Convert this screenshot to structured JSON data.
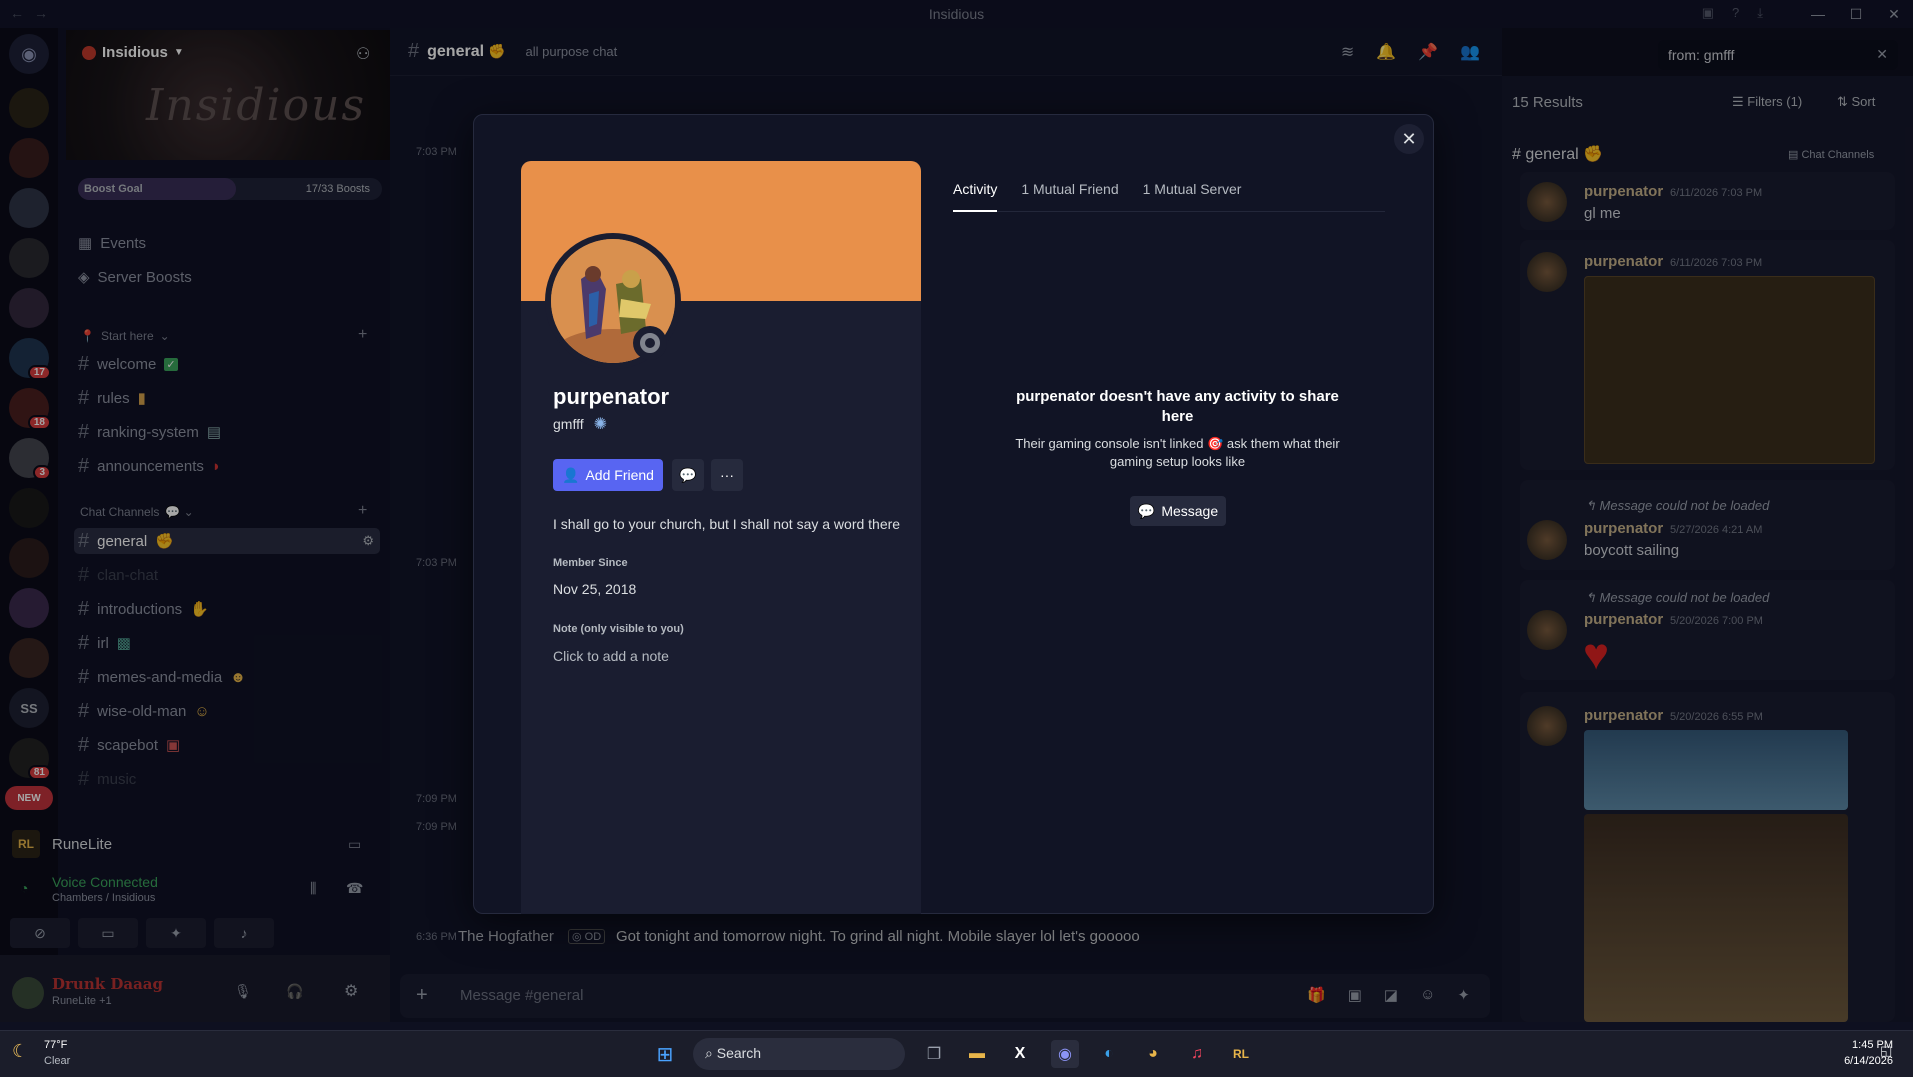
{
  "window": {
    "title": "Insidious"
  },
  "server": {
    "name": "Insidious",
    "banner_text": "Insidious",
    "boost_label": "Boost Goal",
    "boost_count": "17/33 Boosts",
    "boost_progress": 0.52,
    "menu": [
      "Events",
      "Server Boosts"
    ],
    "categories": [
      {
        "label": "Start here",
        "channels": [
          "welcome",
          "rules",
          "ranking-system",
          "announcements"
        ]
      },
      {
        "label": "Chat Channels",
        "channels": [
          "general",
          "clan-chat",
          "introductions",
          "irl",
          "memes-and-media",
          "wise-old-man",
          "scapebot",
          "music"
        ]
      }
    ],
    "server_badges": [
      "17",
      "18",
      "3",
      "81"
    ],
    "new_label": "NEW",
    "ss_label": "SS"
  },
  "sidebar_bottom": {
    "app_name": "RuneLite",
    "voice_status": "Voice Connected",
    "voice_channel": "Chambers / Insidious",
    "user_name": "Drunk Daaag",
    "user_activity": "RuneLite +1"
  },
  "chat": {
    "channel": "general",
    "topic": "all purpose chat",
    "input_placeholder": "Message #general",
    "bottom_msg_time": "6:36 PM",
    "bottom_msg_author": "The Hogfather",
    "bottom_msg_text": "Got tonight and tomorrow night. To grind all night. Mobile slayer lol let's gooooo",
    "bg_times": [
      "7:03 PM",
      "7:03 PM",
      "7:09 PM",
      "7:09 PM"
    ]
  },
  "search": {
    "query": "from: gmfff",
    "results_count": "15 Results",
    "filters_label": "Filters (1)",
    "sort_label": "Sort",
    "channel": "general",
    "channel_category": "Chat Channels",
    "results": [
      {
        "author": "purpenator",
        "time": "6/11/2026 7:03 PM",
        "text": "gl me"
      },
      {
        "author": "purpenator",
        "time": "6/11/2026 7:03 PM",
        "text": ""
      },
      {
        "author": "purpenator",
        "time": "5/27/2026 4:21 AM",
        "text": "boycott sailing",
        "reply": "Message could not be loaded"
      },
      {
        "author": "purpenator",
        "time": "5/20/2026 7:00 PM",
        "text": "",
        "reply": "Message could not be loaded"
      },
      {
        "author": "purpenator",
        "time": "5/20/2026 6:55 PM",
        "text": ""
      }
    ]
  },
  "profile": {
    "display_name": "purpenator",
    "username": "gmfff",
    "banner_color": "#e8904a",
    "add_friend_label": "Add Friend",
    "bio": "I shall go to your church, but I shall not say a word there",
    "member_since_label": "Member Since",
    "member_since": "Nov 25, 2018",
    "note_label": "Note (only visible to you)",
    "note_placeholder": "Click to add a note",
    "tabs": [
      "Activity",
      "1 Mutual Friend",
      "1 Mutual Server"
    ],
    "empty_title": "purpenator doesn't have any activity to share here",
    "empty_sub": "Their gaming console isn't linked 🎯 ask them what their gaming setup looks like",
    "message_label": "Message"
  },
  "taskbar": {
    "weather_temp": "77°F",
    "weather_desc": "Clear",
    "search_label": "Search",
    "time": "1:45 PM",
    "date": "6/14/2026"
  },
  "colors": {
    "accent": "#5865f2",
    "banner": "#e8904a",
    "bg": "#111425"
  }
}
